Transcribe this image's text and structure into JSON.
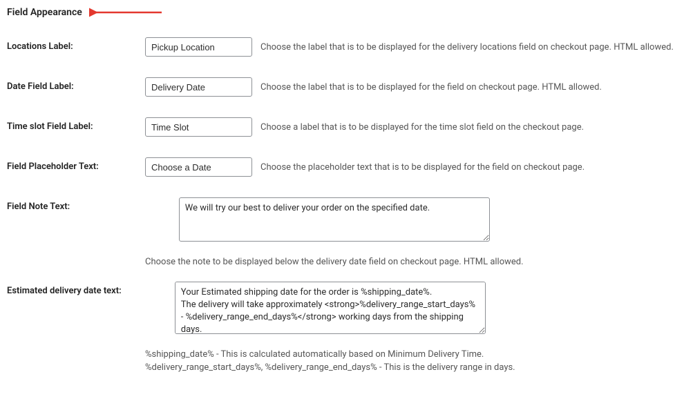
{
  "section_title": "Field Appearance",
  "colors": {
    "arrow": "#e3382e"
  },
  "rows": {
    "locations": {
      "label": "Locations Label:",
      "value": "Pickup Location",
      "desc": "Choose the label that is to be displayed for the delivery locations field on checkout page. HTML allowed."
    },
    "date_field": {
      "label": "Date Field Label:",
      "value": "Delivery Date",
      "desc": "Choose the label that is to be displayed for the field on checkout page. HTML allowed."
    },
    "time_slot": {
      "label": "Time slot Field Label:",
      "value": "Time Slot",
      "desc": "Choose a label that is to be displayed for the time slot field on the checkout page."
    },
    "placeholder": {
      "label": "Field Placeholder Text:",
      "value": "Choose a Date",
      "desc": "Choose the placeholder text that is to be displayed for the field on checkout page."
    },
    "note": {
      "label": "Field Note Text:",
      "value": "We will try our best to deliver your order on the specified date.",
      "desc": "Choose the note to be displayed below the delivery date field on checkout page. HTML allowed."
    },
    "estimated": {
      "label": "Estimated delivery date text:",
      "value": "Your Estimated shipping date for the order is %shipping_date%.\nThe delivery will take approximately <strong>%delivery_range_start_days% - %delivery_range_end_days%</strong> working days from the shipping days.",
      "desc": "%shipping_date% - This is calculated automatically based on Minimum Delivery Time.\n%delivery_range_start_days%, %delivery_range_end_days% - This is the delivery range in days."
    }
  }
}
